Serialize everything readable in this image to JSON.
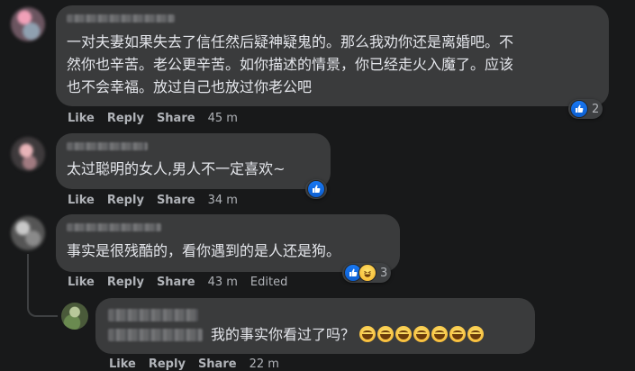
{
  "comments": [
    {
      "text_lines": [
        "一对夫妻如果失去了信任然后疑神疑鬼的。那么我劝你还是离婚吧。不",
        "然你也辛苦。老公更辛苦。如你描述的情景，你已经走火入魔了。应该",
        "也不会幸福。放过自己也放过你老公吧"
      ],
      "actions": {
        "like": "Like",
        "reply": "Reply",
        "share": "Share",
        "time": "45 m"
      },
      "reaction_count": "2",
      "reactions": [
        "like-icon"
      ]
    },
    {
      "text_lines": [
        "太过聪明的女人,男人不一定喜欢~"
      ],
      "actions": {
        "like": "Like",
        "reply": "Reply",
        "share": "Share",
        "time": "34 m"
      },
      "reaction_count": "",
      "reactions": [
        "like-icon"
      ]
    },
    {
      "text_lines": [
        "事实是很残酷的，看你遇到的是人还是狗。"
      ],
      "actions": {
        "like": "Like",
        "reply": "Reply",
        "share": "Share",
        "time": "43 m",
        "edited": "Edited"
      },
      "reaction_count": "3",
      "reactions": [
        "like-icon",
        "haha-icon"
      ]
    }
  ],
  "reply": {
    "text": "我的事实你看过了吗？",
    "emoji": [
      "laugh-emoji",
      "laugh-emoji",
      "laugh-emoji",
      "laugh-emoji",
      "laugh-emoji",
      "laugh-emoji",
      "laugh-emoji"
    ],
    "actions": {
      "like": "Like",
      "reply": "Reply",
      "share": "Share",
      "time": "22 m"
    }
  },
  "colors": {
    "background": "#18191a",
    "bubble": "#3a3b3c",
    "action_text": "#b0b3b8",
    "like_blue": "#1877f2"
  }
}
